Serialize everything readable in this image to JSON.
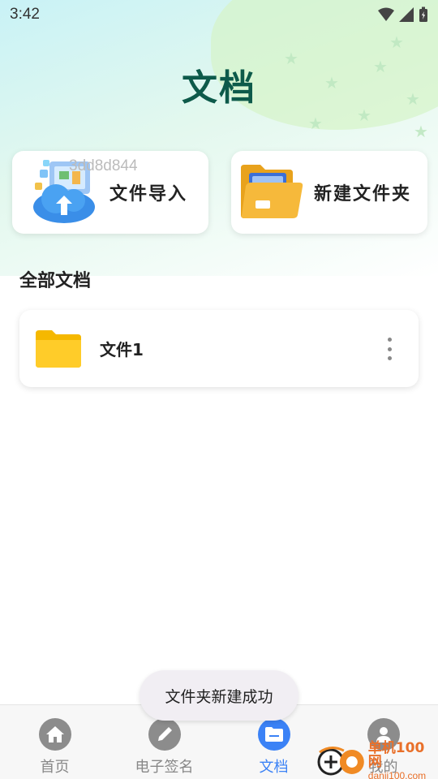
{
  "status_bar": {
    "time": "3:42"
  },
  "page": {
    "title": "文档"
  },
  "actions": {
    "import_label": "文件导入",
    "new_folder_label": "新建文件夹",
    "watermark": "3dd8d844"
  },
  "section": {
    "title": "全部文档"
  },
  "files": [
    {
      "name": "文件1"
    }
  ],
  "toast": {
    "message": "文件夹新建成功"
  },
  "tabs": [
    {
      "label": "首页",
      "icon": "home-icon",
      "active": false
    },
    {
      "label": "电子签名",
      "icon": "pen-icon",
      "active": false
    },
    {
      "label": "文档",
      "icon": "folder-icon",
      "active": true
    },
    {
      "label": "我的",
      "icon": "user-icon",
      "active": false
    }
  ],
  "site_logo": {
    "name": "单机100网",
    "url": "danji100.com"
  },
  "colors": {
    "accent": "#3b82f6",
    "title": "#0d5a4a",
    "folder": "#fbc02d"
  }
}
